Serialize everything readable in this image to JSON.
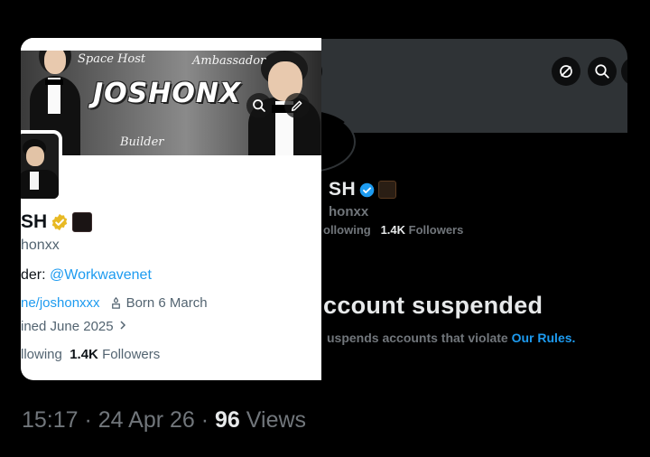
{
  "light_profile": {
    "banner": {
      "logo_text": "JOSHONX",
      "caption_space_host": "Space Host",
      "caption_ambassador": "Ambassador",
      "caption_builder": "Builder"
    },
    "name": "SH",
    "handle": "honxx",
    "bio_prefix": "der: ",
    "bio_link": "@Workwavenet",
    "website": "ne/joshonxxx",
    "born": "Born 6 March",
    "joined": "ined June 2025",
    "following_label": "llowing",
    "followers_count": "1.4K",
    "followers_label": "Followers",
    "colors": {
      "gold_badge": "#e8b923",
      "link": "#1d9bf0"
    }
  },
  "dark_profile": {
    "name": "SH",
    "handle": "honxx",
    "following_label": "ollowing",
    "followers_count": "1.4K",
    "followers_label": "Followers",
    "suspended_title": "ccount suspended",
    "suspended_text": "uspends accounts that violate ",
    "rules_link": "Our Rules",
    "rules_period": ".",
    "colors": {
      "blue_badge": "#1d9bf0",
      "banner": "#2f3336"
    }
  },
  "footer": {
    "time": "15:17",
    "sep1": " · ",
    "date": "24 Apr 26",
    "sep2": " · ",
    "views_count": "96",
    "views_label": " Views"
  },
  "icons": [
    "search-icon",
    "edit-icon",
    "link-icon",
    "verified-icon",
    "cake-icon",
    "chevron-right-icon"
  ]
}
